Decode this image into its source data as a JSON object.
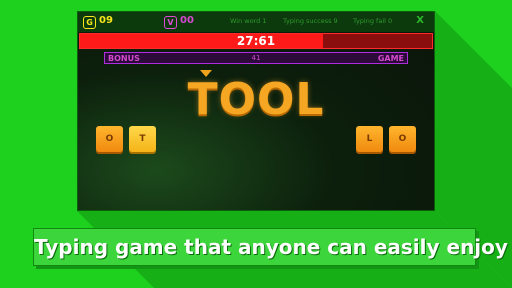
{
  "colors": {
    "background": "#1ed11e",
    "gold": "#f5e61a",
    "violet": "#d449d0",
    "timer": "#ff1a1a",
    "tile": "#f5a623"
  },
  "topbar": {
    "gold_icon": "G",
    "gold_count": "09",
    "v_icon": "V",
    "v_count": "00",
    "win_word": "Win word 1",
    "typing_success": "Typing success 9",
    "typing_fail": "Typing fail 0",
    "close": "X"
  },
  "timer": {
    "text": "27:61",
    "remaining_fraction": 0.69
  },
  "bonus_bar": {
    "left_label": "BONUS",
    "value": "41",
    "right_label": "GAME"
  },
  "current_word": "TOOL",
  "tiles_left": [
    "O",
    "T"
  ],
  "tiles_right": [
    "L",
    "O"
  ],
  "caption": "Typing game that anyone can easily enjoy"
}
